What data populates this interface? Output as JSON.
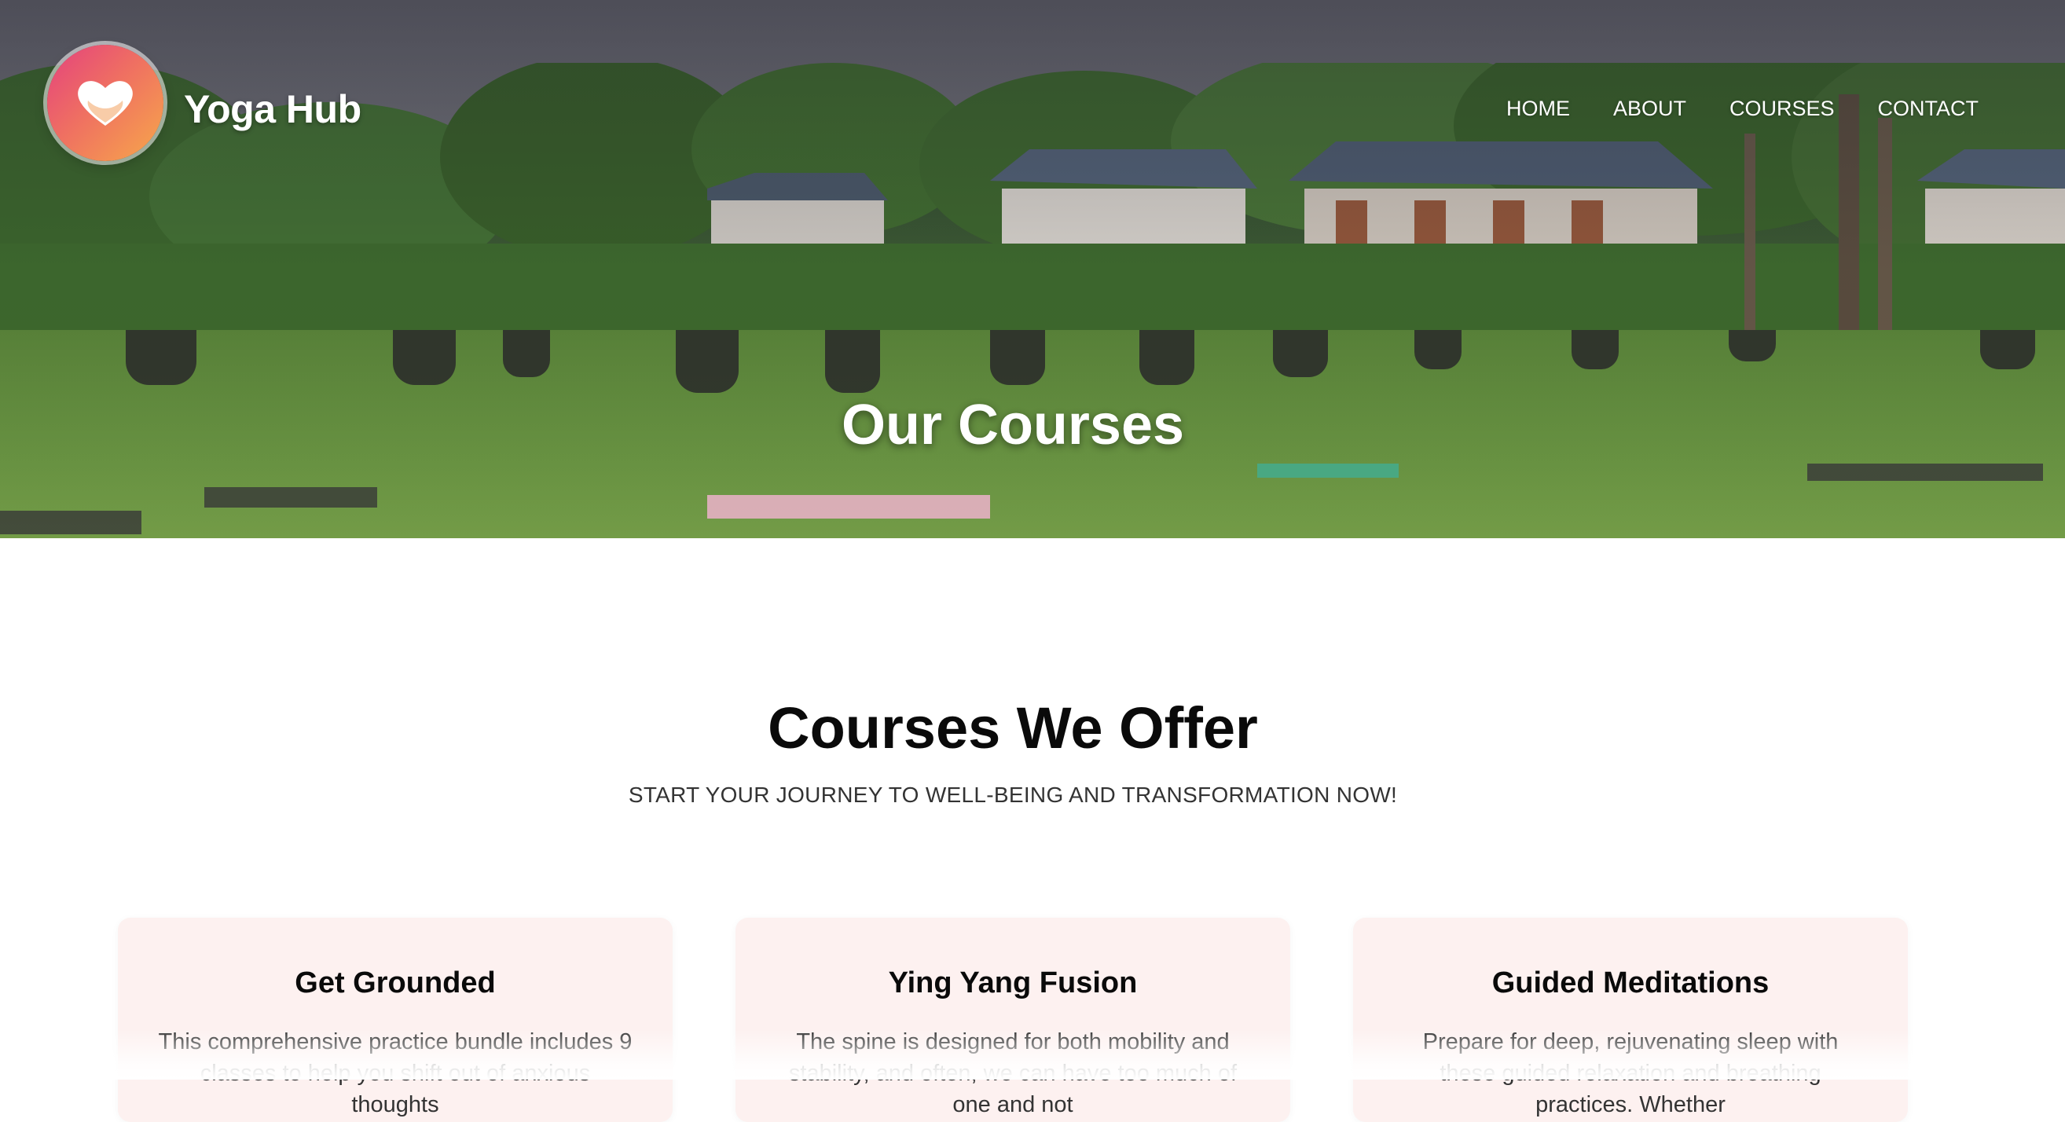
{
  "brand": {
    "name": "Yoga Hub",
    "logo_icon": "heart-icon"
  },
  "nav": {
    "items": [
      {
        "label": "HOME"
      },
      {
        "label": "ABOUT"
      },
      {
        "label": "COURSES"
      },
      {
        "label": "CONTACT"
      }
    ]
  },
  "hero": {
    "title": "Our Courses",
    "image": "outdoor-group-yoga-photo"
  },
  "section": {
    "title": "Courses We Offer",
    "subtitle": "START YOUR JOURNEY TO WELL-BEING AND TRANSFORMATION NOW!"
  },
  "courses": [
    {
      "title": "Get Grounded",
      "description": "This comprehensive practice bundle includes 9 classes to help you shift out of anxious thoughts"
    },
    {
      "title": "Ying Yang Fusion",
      "description": "The spine is designed for both mobility and stability, and often, we can have too much of one and not"
    },
    {
      "title": "Guided Meditations",
      "description": "Prepare for deep, rejuvenating sleep with these guided relaxation and breathing practices. Whether"
    }
  ],
  "colors": {
    "logo_gradient_start": "#e4417e",
    "logo_gradient_end": "#f7a84a",
    "card_background": "#fdf1f0",
    "text_dark": "#0a0a0a"
  }
}
